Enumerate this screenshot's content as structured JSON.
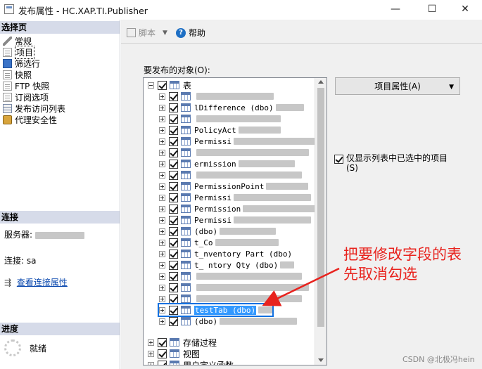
{
  "window": {
    "title": "发布属性 - HC.XAP.TI.Publisher",
    "controls": {
      "minimize": "—",
      "maximize": "☐",
      "close": "✕"
    }
  },
  "left_panel": {
    "select_page_header": "选择页",
    "nav_items": [
      {
        "label": "常规",
        "icon": "wrench-icon"
      },
      {
        "label": "项目",
        "icon": "page-icon",
        "selected": true
      },
      {
        "label": "筛选行",
        "icon": "filter-icon"
      },
      {
        "label": "快照",
        "icon": "snapshot-icon"
      },
      {
        "label": "FTP 快照",
        "icon": "ftp-icon"
      },
      {
        "label": "订阅选项",
        "icon": "subscription-icon"
      },
      {
        "label": "发布访问列表",
        "icon": "access-list-icon"
      },
      {
        "label": "代理安全性",
        "icon": "lock-icon"
      }
    ],
    "connection_header": "连接",
    "server_label": "服务器:",
    "connection_label": "连接: sa",
    "view_connection_link": "查看连接属性",
    "progress_header": "进度",
    "progress_status": "就绪"
  },
  "toolbar": {
    "script_label": "脚本",
    "help_label": "帮助"
  },
  "main": {
    "objects_label": "要发布的对象(O):",
    "tree": {
      "root_tables_label": "表",
      "tables": [
        {
          "text": "",
          "checked": true
        },
        {
          "text": "lDifference (dbo)",
          "checked": true
        },
        {
          "text": "",
          "checked": true
        },
        {
          "text": "PolicyAct",
          "checked": true
        },
        {
          "text": "Permissi",
          "checked": true
        },
        {
          "text": "",
          "checked": true
        },
        {
          "text": "ermission",
          "checked": true
        },
        {
          "text": "",
          "checked": true
        },
        {
          "text": "PermissionPoint",
          "checked": true
        },
        {
          "text": "Permissi",
          "checked": true
        },
        {
          "text": "Permission",
          "checked": true
        },
        {
          "text": "Permissi",
          "checked": true
        },
        {
          "text": "(dbo)",
          "checked": true
        },
        {
          "text": "t_Co",
          "checked": true
        },
        {
          "text": "t_nventory Part (dbo)",
          "checked": true
        },
        {
          "text": "t_ ntory Qty (dbo)",
          "checked": true
        },
        {
          "text": "",
          "checked": true
        },
        {
          "text": "",
          "checked": true
        },
        {
          "text": "",
          "checked": true
        },
        {
          "text": "testTab (dbo)",
          "checked": true,
          "selected": true
        },
        {
          "text": "(dbo)",
          "checked": true
        }
      ],
      "folders": [
        {
          "text": "存储过程",
          "checked": true
        },
        {
          "text": "视图",
          "checked": true
        },
        {
          "text": "用户定义函数",
          "checked": true
        }
      ]
    },
    "property_button": "项目属性(A)",
    "only_show_checkbox": "仅显示列表中已选中的项目(S)"
  },
  "annotation": {
    "text": "把要修改字段的表先取消勾选",
    "color": "#e8231e"
  },
  "watermark": "CSDN @北极冯hein"
}
